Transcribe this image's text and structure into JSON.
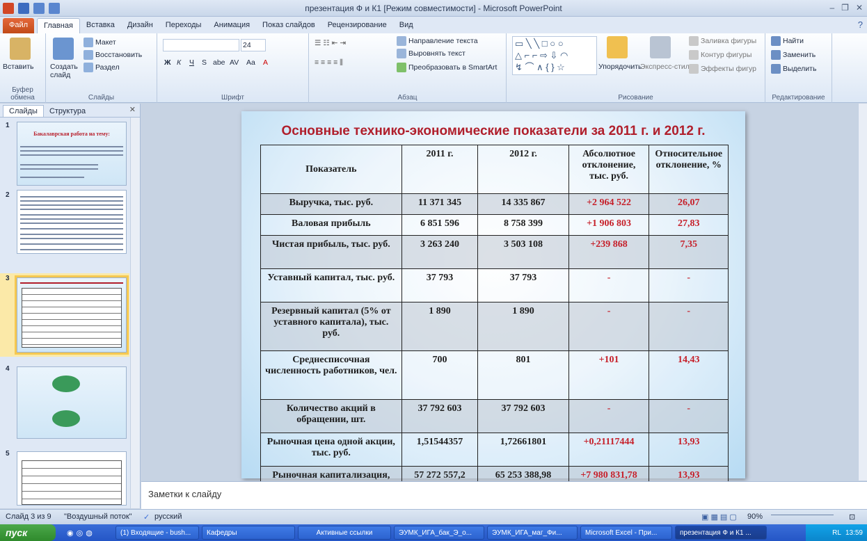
{
  "window": {
    "title": "презентация Ф и К1 [Режим совместимости]  -  Microsoft PowerPoint",
    "controls": [
      "–",
      "❐",
      "✕"
    ]
  },
  "ribbon_tabs": [
    "Файл",
    "Главная",
    "Вставка",
    "Дизайн",
    "Переходы",
    "Анимация",
    "Показ слайдов",
    "Рецензирование",
    "Вид"
  ],
  "ribbon": {
    "clipboard": {
      "paste": "Вставить",
      "label": "Буфер обмена"
    },
    "slides": {
      "new_slide": "Создать слайд",
      "layout": "Макет",
      "reset": "Восстановить",
      "section": "Раздел",
      "label": "Слайды"
    },
    "font": {
      "size": "24",
      "label": "Шрифт",
      "bold": "Ж",
      "italic": "К",
      "underline": "Ч",
      "strike": "S",
      "shadow": "abe",
      "spacing": "AV",
      "case": "Aa",
      "color": "A"
    },
    "paragraph": {
      "text_direction": "Направление текста",
      "align_text": "Выровнять текст",
      "smartart": "Преобразовать в SmartArt",
      "label": "Абзац"
    },
    "drawing": {
      "arrange": "Упорядочить",
      "quick_styles": "Экспресс-стили",
      "shape_fill": "Заливка фигуры",
      "shape_outline": "Контур фигуры",
      "shape_effects": "Эффекты фигур",
      "label": "Рисование"
    },
    "editing": {
      "find": "Найти",
      "replace": "Заменить",
      "select": "Выделить",
      "label": "Редактирование"
    }
  },
  "pane": {
    "tabs": [
      "Слайды",
      "Структура"
    ],
    "thumbnails": [
      {
        "num": "1",
        "title": "Бакалаврская работа на тему:"
      },
      {
        "num": "2",
        "title": ""
      },
      {
        "num": "3",
        "title": ""
      },
      {
        "num": "4",
        "title": ""
      },
      {
        "num": "5",
        "title": ""
      }
    ]
  },
  "slide": {
    "title": "Основные технико-экономические показатели за 2011 г. и 2012 г.",
    "table": {
      "headers": [
        "Показатель",
        "2011 г.",
        "2012 г.",
        "Абсолютное отклонение, тыс. руб.",
        "Относительное отклонение, %"
      ],
      "rows": [
        [
          "Выручка, тыс. руб.",
          "11 371 345",
          "14 335 867",
          "+2 964 522",
          "26,07"
        ],
        [
          "Валовая прибыль",
          "6 851 596",
          "8 758 399",
          "+1 906 803",
          "27,83"
        ],
        [
          "Чистая прибыль, тыс. руб.",
          "3 263 240",
          "3 503 108",
          "+239 868",
          "7,35"
        ],
        [
          "Уставный капитал, тыс. руб.",
          "37 793",
          "37 793",
          "-",
          "-"
        ],
        [
          "Резервный капитал (5% от уставного капитала), тыс. руб.",
          "1 890",
          "1 890",
          "-",
          "-"
        ],
        [
          "Среднесписочная численность работников, чел.",
          "700",
          "801",
          "+101",
          "14,43"
        ],
        [
          "Количество акций в обращении, шт.",
          "37 792 603",
          "37 792 603",
          "-",
          "-"
        ],
        [
          "Рыночная цена одной акции, тыс. руб.",
          "1,51544357",
          "1,72661801",
          "+0,21117444",
          "13,93"
        ],
        [
          "Рыночная капитализация, тыс. руб.",
          "57 272 557,2",
          "65 253 388,98",
          "+7 980 831,78",
          "13,93"
        ]
      ]
    }
  },
  "notes": {
    "placeholder": "Заметки к слайду"
  },
  "status": {
    "slide": "Слайд 3 из 9",
    "theme": "\"Воздушный поток\"",
    "lang": "русский",
    "zoom": "90%"
  },
  "taskbar": {
    "start": "пуск",
    "items": [
      "(1) Входящие - bush...",
      "Кафедры",
      "Активные ссылки",
      "ЭУМК_ИГА_бак_Э_о...",
      "ЭУМК_ИГА_маг_Фи...",
      "Microsoft Excel - При...",
      "презентация Ф и К1 ..."
    ],
    "tray_lang": "RL",
    "clock": "13:59"
  },
  "colors": {
    "title_red": "#b01e2b",
    "value_red": "#c6202a",
    "selection": "#f5c851",
    "taskbar": "#2456c6"
  }
}
